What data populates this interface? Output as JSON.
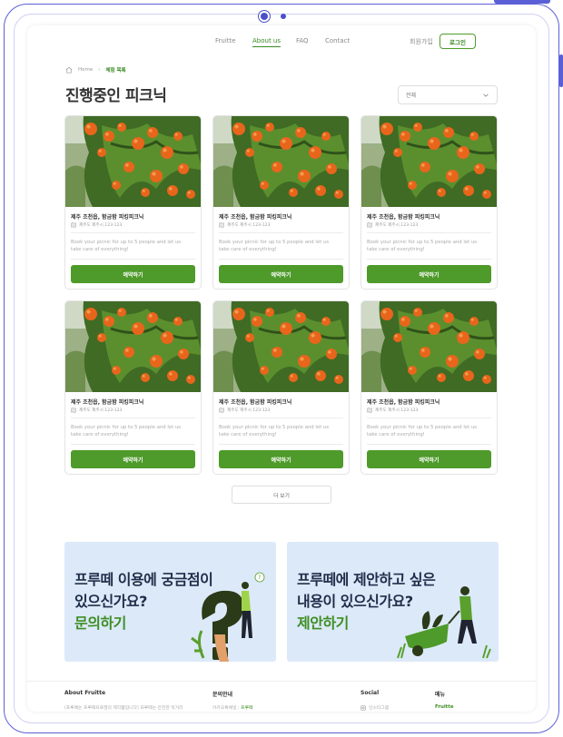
{
  "nav": {
    "links": [
      "Fruitte",
      "About us",
      "FAQ",
      "Contact"
    ],
    "signup": "회원가입",
    "login": "로그인"
  },
  "breadcrumb": {
    "home": "Home",
    "current": "체험 목록"
  },
  "page_title": "진행중인 피크닉",
  "filter": {
    "selected": "전체"
  },
  "card": {
    "title": "제주 조천읍, 함금함 피킹피크닉",
    "address": "제주도 제주시 123-123",
    "description": "Book your picnic for up to 5 people and let us take care of everything!",
    "book_label": "예약하기"
  },
  "cards_count": 6,
  "more_label": "더 보기",
  "banners": [
    {
      "line1": "프루떼 이용에 궁금점이",
      "line2": "있으신가요?",
      "cta": "문의하기"
    },
    {
      "line1": "프루떼에 제안하고 싶은",
      "line2": "내용이 있으신가요?",
      "cta": "제안하기"
    }
  ],
  "footer": {
    "about_title": "About Fruitte",
    "about_text": "(프루떼는 프루떼프로젠의 제작품입니다) 프루떼는 안전한 먹거리",
    "inquiry_title": "문의안내",
    "inquiry_text": "카카오톡채널 : ",
    "inquiry_channel": "프루떼",
    "social_title": "Social",
    "social_text": "인스타그램",
    "menu_title": "메뉴",
    "menu_text": "Fruitte"
  },
  "colors": {
    "accent": "#4e9a2a",
    "frame": "#5b5fd6",
    "banner_bg": "#dce9f9"
  }
}
